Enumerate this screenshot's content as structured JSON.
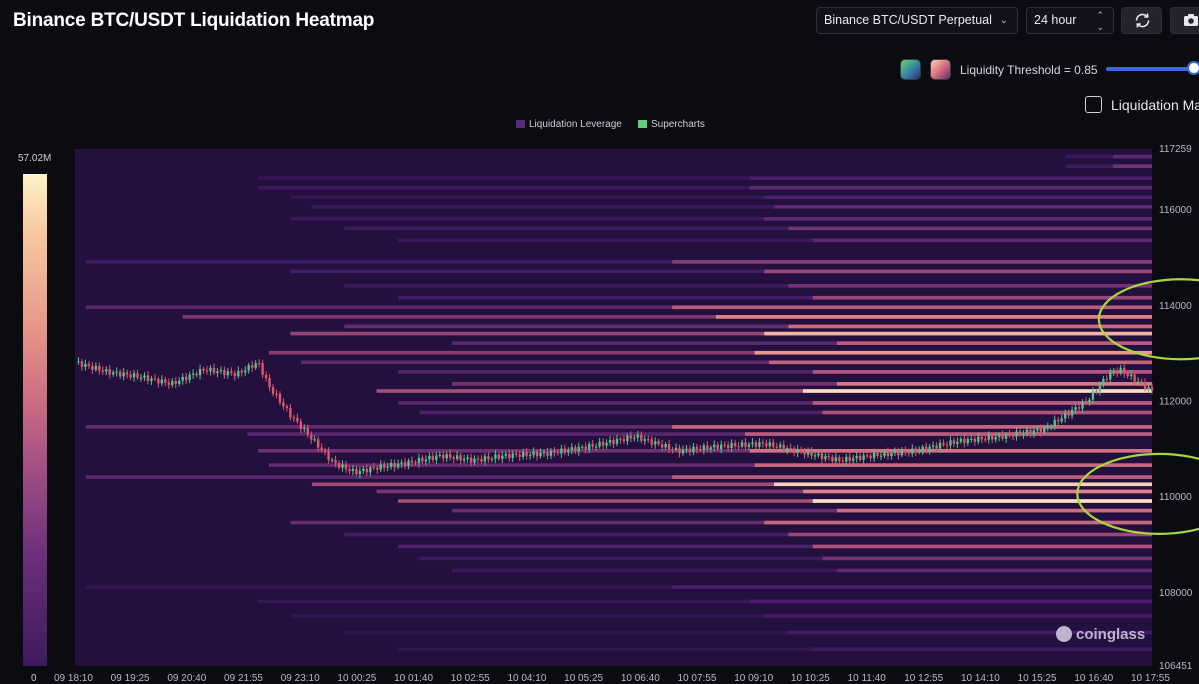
{
  "header": {
    "title": "Binance BTC/USDT Liquidation Heatmap",
    "pair_select": "Binance BTC/USDT Perpetual",
    "range_select": "24 hour",
    "refresh_icon": "refresh-icon",
    "camera_icon": "camera-icon"
  },
  "controls": {
    "threshold_label": "Liquidity Threshold = 0.85",
    "threshold_value": 0.85,
    "checkbox_label": "Liquidation Ma"
  },
  "legend": {
    "items": [
      "Liquidation Leverage",
      "Supercharts"
    ],
    "colors": [
      "#5a2a7a",
      "#5fce7d"
    ]
  },
  "color_scale": {
    "max_label": "57.02M",
    "min_label": "0"
  },
  "watermark": "coinglass",
  "chart_data": {
    "type": "heatmap",
    "title": "",
    "ylim": [
      106451,
      117259
    ],
    "y_ticks": [
      "117259",
      "116000",
      "114000",
      "112000",
      "110000",
      "108000",
      "106451"
    ],
    "x_ticks": [
      "09 18:10",
      "09 19:25",
      "09 20:40",
      "09 21:55",
      "09 23:10",
      "10 00:25",
      "10 01:40",
      "10 02:55",
      "10 04:10",
      "10 05:25",
      "10 06:40",
      "10 07:55",
      "10 09:10",
      "10 10:25",
      "10 11:40",
      "10 12:55",
      "10 14:10",
      "10 15:25",
      "10 16:40",
      "10 17:55"
    ],
    "colors": {
      "background": "#24103e",
      "low": "#4a1f6e",
      "mid": "#b0517c",
      "high": "#e88a84",
      "peak": "#fff3d0",
      "candle_up": "#52c48a",
      "candle_down": "#e0566e",
      "highlight_ellipse": "#a8d83a"
    },
    "liquidation_levels": [
      {
        "price": 117100,
        "start": 0.92,
        "intensity": 0.3
      },
      {
        "price": 116900,
        "start": 0.92,
        "intensity": 0.35
      },
      {
        "price": 116650,
        "start": 0.17,
        "intensity": 0.25
      },
      {
        "price": 116450,
        "start": 0.17,
        "intensity": 0.3
      },
      {
        "price": 116250,
        "start": 0.2,
        "intensity": 0.25
      },
      {
        "price": 116050,
        "start": 0.22,
        "intensity": 0.3
      },
      {
        "price": 115800,
        "start": 0.2,
        "intensity": 0.3
      },
      {
        "price": 115600,
        "start": 0.25,
        "intensity": 0.35
      },
      {
        "price": 115350,
        "start": 0.3,
        "intensity": 0.3
      },
      {
        "price": 114900,
        "start": 0.01,
        "intensity": 0.4
      },
      {
        "price": 114700,
        "start": 0.2,
        "intensity": 0.45
      },
      {
        "price": 114400,
        "start": 0.25,
        "intensity": 0.35
      },
      {
        "price": 114150,
        "start": 0.3,
        "intensity": 0.45
      },
      {
        "price": 113950,
        "start": 0.01,
        "intensity": 0.55
      },
      {
        "price": 113750,
        "start": 0.1,
        "intensity": 0.72
      },
      {
        "price": 113550,
        "start": 0.25,
        "intensity": 0.62
      },
      {
        "price": 113400,
        "start": 0.2,
        "intensity": 0.85
      },
      {
        "price": 113200,
        "start": 0.35,
        "intensity": 0.55
      },
      {
        "price": 113000,
        "start": 0.18,
        "intensity": 0.78
      },
      {
        "price": 112800,
        "start": 0.21,
        "intensity": 0.58
      },
      {
        "price": 112600,
        "start": 0.3,
        "intensity": 0.52
      },
      {
        "price": 112350,
        "start": 0.35,
        "intensity": 0.68
      },
      {
        "price": 112200,
        "start": 0.28,
        "intensity": 0.95
      },
      {
        "price": 111950,
        "start": 0.3,
        "intensity": 0.55
      },
      {
        "price": 111750,
        "start": 0.32,
        "intensity": 0.5
      },
      {
        "price": 111450,
        "start": 0.01,
        "intensity": 0.6
      },
      {
        "price": 111300,
        "start": 0.16,
        "intensity": 0.55
      },
      {
        "price": 110950,
        "start": 0.17,
        "intensity": 0.65
      },
      {
        "price": 110650,
        "start": 0.18,
        "intensity": 0.6
      },
      {
        "price": 110400,
        "start": 0.01,
        "intensity": 0.55
      },
      {
        "price": 110250,
        "start": 0.22,
        "intensity": 0.92
      },
      {
        "price": 110100,
        "start": 0.28,
        "intensity": 0.72
      },
      {
        "price": 109900,
        "start": 0.3,
        "intensity": 0.96
      },
      {
        "price": 109700,
        "start": 0.35,
        "intensity": 0.62
      },
      {
        "price": 109450,
        "start": 0.2,
        "intensity": 0.6
      },
      {
        "price": 109200,
        "start": 0.25,
        "intensity": 0.45
      },
      {
        "price": 108950,
        "start": 0.3,
        "intensity": 0.5
      },
      {
        "price": 108700,
        "start": 0.32,
        "intensity": 0.35
      },
      {
        "price": 108450,
        "start": 0.35,
        "intensity": 0.3
      },
      {
        "price": 108100,
        "start": 0.01,
        "intensity": 0.25
      },
      {
        "price": 107800,
        "start": 0.17,
        "intensity": 0.25
      },
      {
        "price": 107500,
        "start": 0.2,
        "intensity": 0.2
      },
      {
        "price": 107150,
        "start": 0.25,
        "intensity": 0.2
      },
      {
        "price": 106800,
        "start": 0.3,
        "intensity": 0.18
      }
    ],
    "price_series": {
      "t": [
        0,
        0.03,
        0.06,
        0.09,
        0.12,
        0.15,
        0.17,
        0.18,
        0.2,
        0.22,
        0.24,
        0.26,
        0.28,
        0.31,
        0.34,
        0.37,
        0.4,
        0.44,
        0.48,
        0.52,
        0.56,
        0.6,
        0.64,
        0.68,
        0.71,
        0.74,
        0.78,
        0.82,
        0.86,
        0.9,
        0.92,
        0.94,
        0.96,
        0.97,
        0.99,
        1.0
      ],
      "price": [
        112800,
        112600,
        112500,
        112350,
        112650,
        112550,
        112800,
        112300,
        111700,
        111200,
        110700,
        110500,
        110600,
        110700,
        110850,
        110750,
        110850,
        110900,
        111050,
        111250,
        110950,
        111050,
        111100,
        110900,
        110750,
        110850,
        110950,
        111150,
        111250,
        111400,
        111700,
        112000,
        112550,
        112650,
        112350,
        112200
      ]
    },
    "highlight_ellipses": [
      {
        "price": 113700,
        "t": 0.985
      },
      {
        "price": 110050,
        "t": 0.965
      }
    ]
  }
}
